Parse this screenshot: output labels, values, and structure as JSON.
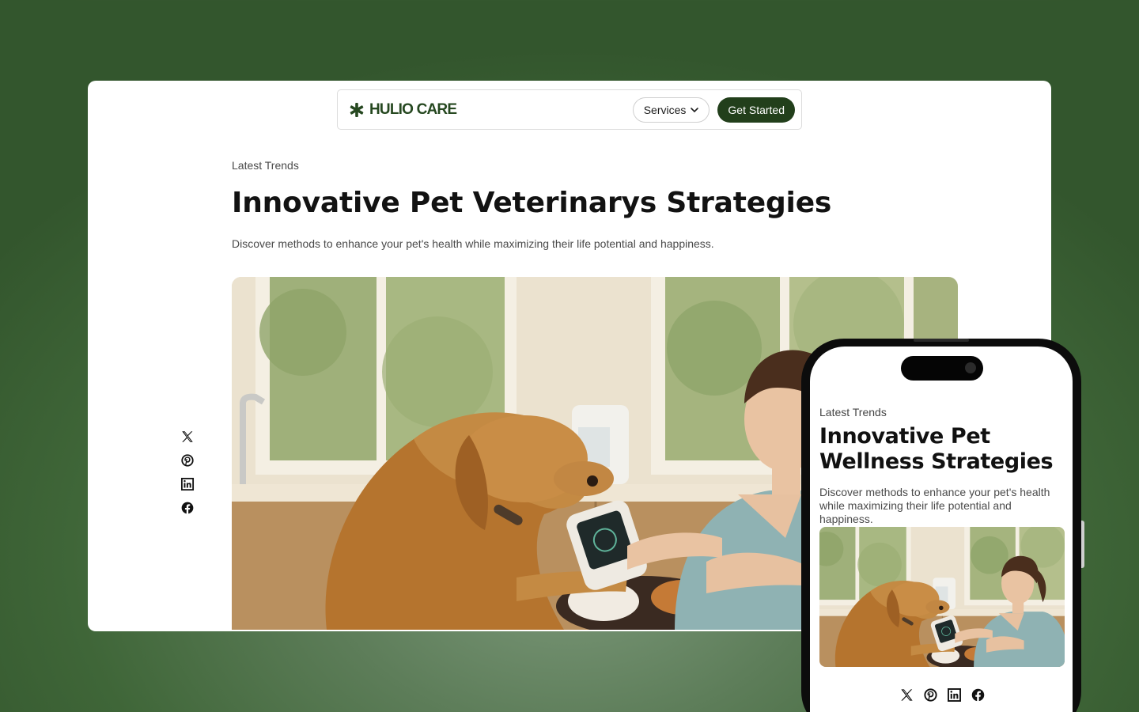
{
  "brand": {
    "name": "HULIO CARE",
    "color": "#264820"
  },
  "nav": {
    "services_label": "Services",
    "cta_label": "Get Started",
    "cta_color": "#223f1b"
  },
  "article": {
    "eyebrow": "Latest Trends",
    "headline": "Innovative Pet Veterinarys Strategies",
    "subtext": "Discover methods to enhance your pet's health while maximizing their life potential and happiness.",
    "hero_image": "golden retriever and calico cat with veterinarian holding a device in a bright kitchen"
  },
  "social": [
    "x-icon",
    "pinterest-icon",
    "linkedin-icon",
    "facebook-icon"
  ],
  "mobile": {
    "eyebrow": "Latest Trends",
    "headline": "Innovative Pet Wellness Strategies",
    "subtext": "Discover methods to enhance your pet's health while maximizing their life potential and happiness."
  },
  "colors": {
    "background": "#3f6638",
    "accent": "#223f1b"
  }
}
